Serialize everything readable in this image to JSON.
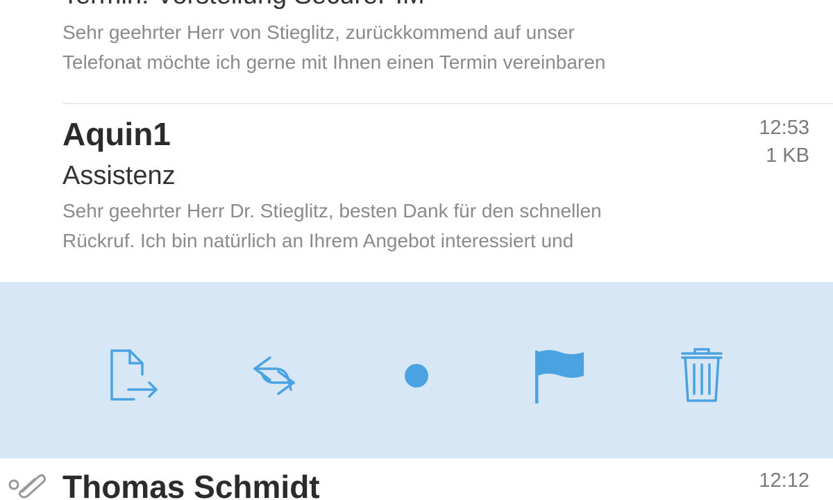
{
  "accent_color": "#4aa3e0",
  "messages": [
    {
      "subject": "Termin: Vorstellung SecurePIM",
      "preview_line1": "Sehr geehrter Herr von Stieglitz, zurückkommend auf unser",
      "preview_line2": "Telefonat möchte ich gerne mit Ihnen einen Termin vereinbaren"
    },
    {
      "sender": "Aquin1",
      "time": "12:53",
      "size": "1 KB",
      "subject": "Assistenz",
      "preview_line1": "Sehr geehrter Herr Dr. Stieglitz, besten Dank für den schnellen",
      "preview_line2": "Rückruf. Ich bin natürlich an Ihrem Angebot interessiert und"
    },
    {
      "sender": "Thomas Schmidt",
      "time": "12:12"
    }
  ],
  "actions": [
    {
      "icon": "move-to-folder-icon"
    },
    {
      "icon": "reply-forward-icon"
    },
    {
      "icon": "mark-unread-dot-icon"
    },
    {
      "icon": "flag-icon"
    },
    {
      "icon": "trash-icon"
    }
  ]
}
